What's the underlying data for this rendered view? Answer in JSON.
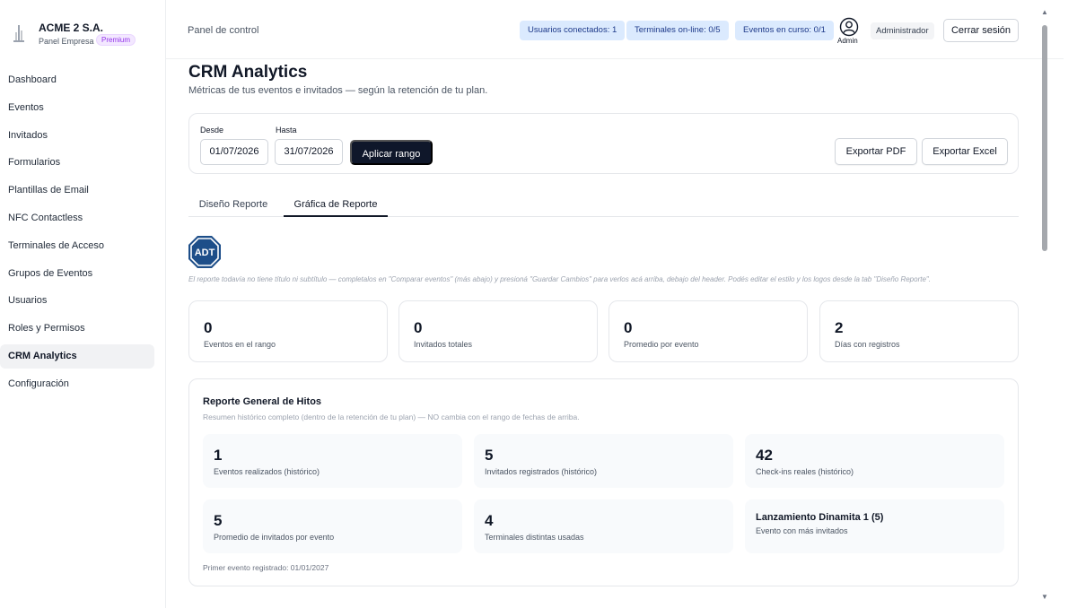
{
  "brand": {
    "name": "ACME 2 S.A.",
    "subtitle": "Panel Empresa",
    "badge": "Premium"
  },
  "sidebar": {
    "items": [
      {
        "label": "Dashboard",
        "active": false
      },
      {
        "label": "Eventos",
        "active": false
      },
      {
        "label": "Invitados",
        "active": false
      },
      {
        "label": "Formularios",
        "active": false
      },
      {
        "label": "Plantillas de Email",
        "active": false
      },
      {
        "label": "NFC Contactless",
        "active": false
      },
      {
        "label": "Terminales de Acceso",
        "active": false
      },
      {
        "label": "Grupos de Eventos",
        "active": false
      },
      {
        "label": "Usuarios",
        "active": false
      },
      {
        "label": "Roles y Permisos",
        "active": false
      },
      {
        "label": "CRM Analytics",
        "active": true
      },
      {
        "label": "Configuración",
        "active": false
      }
    ]
  },
  "header": {
    "title": "Panel de control",
    "pills": {
      "users": "Usuarios conectados: 1",
      "terminals": "Terminales on-line: 0/5",
      "events": "Eventos en curso: 0/1"
    },
    "admin_label": "Admin",
    "role": "Administrador",
    "logout": "Cerrar sesión"
  },
  "page": {
    "title": "CRM Analytics",
    "subtitle": "Métricas de tus eventos e invitados — según la retención de tu plan."
  },
  "range": {
    "from_label": "Desde",
    "from_value": "01/07/2026",
    "to_label": "Hasta",
    "to_value": "31/07/2026",
    "apply": "Aplicar rango",
    "export_pdf": "Exportar PDF",
    "export_excel": "Exportar Excel"
  },
  "tabs": [
    {
      "label": "Diseño Reporte",
      "active": false
    },
    {
      "label": "Gráfica de Reporte",
      "active": true
    }
  ],
  "report": {
    "logo_text": "ADT",
    "note": "El reporte todavía no tiene título ni subtítulo — completalos en \"Comparar eventos\" (más abajo) y presioná \"Guardar Cambios\" para verlos acá arriba, debajo del header. Podés editar el estilo y los logos desde la tab \"Diseño Reporte\"."
  },
  "stats": [
    {
      "value": "0",
      "label": "Eventos en el rango"
    },
    {
      "value": "0",
      "label": "Invitados totales"
    },
    {
      "value": "0",
      "label": "Promedio por evento"
    },
    {
      "value": "2",
      "label": "Días con registros"
    }
  ],
  "hitos": {
    "title": "Reporte General de Hitos",
    "subtitle": "Resumen histórico completo (dentro de la retención de tu plan) — NO cambia con el rango de fechas de arriba.",
    "items": [
      {
        "value": "1",
        "label": "Eventos realizados (histórico)"
      },
      {
        "value": "5",
        "label": "Invitados registrados (histórico)"
      },
      {
        "value": "42",
        "label": "Check-ins reales (histórico)"
      },
      {
        "value": "5",
        "label": "Promedio de invitados por evento"
      },
      {
        "value": "4",
        "label": "Terminales distintas usadas"
      },
      {
        "value": "Lanzamiento Dinamita 1 (5)",
        "label": "Evento con más invitados"
      }
    ],
    "footer": "Primer evento registrado: 01/01/2027"
  },
  "colors": {
    "accent_dark": "#0f172a",
    "pill_bg": "#dbeafe",
    "premium": "#9333ea",
    "adt_blue": "#1d4e89"
  },
  "icons": {
    "brand": "building-icon",
    "admin": "user-circle-icon",
    "report_logo": "adt-octagon-icon"
  }
}
